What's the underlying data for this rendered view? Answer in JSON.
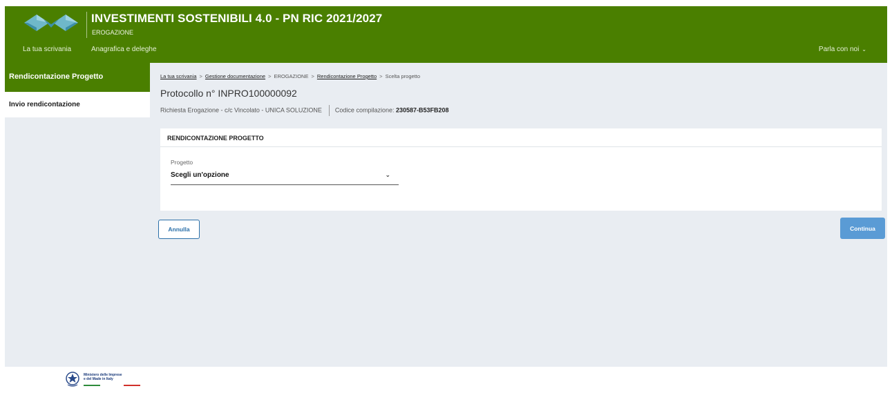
{
  "header": {
    "title": "INVESTIMENTI SOSTENIBILI 4.0 - PN RIC 2021/2027",
    "subtitle": "EROGAZIONE",
    "nav": [
      "La tua scrivania",
      "Anagrafica e deleghe"
    ],
    "contact": "Parla con noi",
    "contact_icon": "chevron-down-icon",
    "brand_color": "#4a7f00"
  },
  "sidebar": {
    "title": "Rendicontazione Progetto",
    "items": [
      {
        "label": "Invio rendicontazione"
      }
    ]
  },
  "breadcrumb": {
    "items": [
      {
        "label": "La tua scrivania",
        "link": true
      },
      {
        "label": "Gestione documentazione",
        "link": true
      },
      {
        "label": "EROGAZIONE",
        "link": false
      },
      {
        "label": "Rendicontazione Progetto",
        "link": true
      },
      {
        "label": "Scelta progetto",
        "link": false
      }
    ],
    "separator": ">"
  },
  "protocol": {
    "title": "Protocollo n° INPRO100000092",
    "info": "Richiesta Erogazione - c/c Vincolato  -  UNICA SOLUZIONE",
    "code_label": "Codice compilazione:",
    "code_value": "230587-B53FB208"
  },
  "card": {
    "title": "RENDICONTAZIONE PROGETTO",
    "field_label": "Progetto",
    "select_value": "Scegli un'opzione"
  },
  "buttons": {
    "cancel": "Annulla",
    "continue": "Continua",
    "continue_color": "#5a9bd5"
  },
  "footer": {
    "ministry_line1": "Ministero delle Imprese",
    "ministry_line2": "e del Made in Italy"
  }
}
